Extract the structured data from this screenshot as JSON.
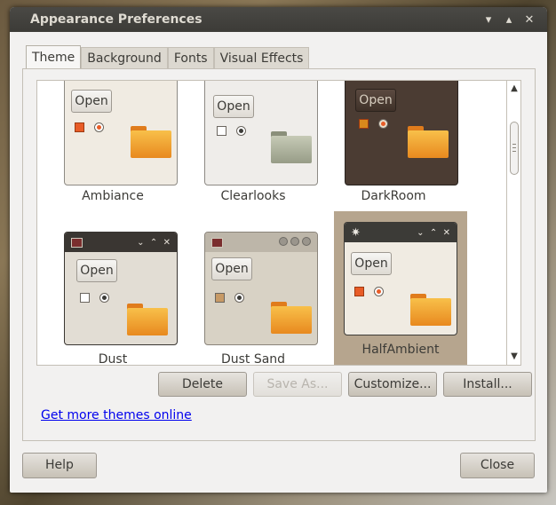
{
  "window": {
    "title": "Appearance Preferences"
  },
  "titlebar_controls": [
    "▾",
    "▴",
    "✕"
  ],
  "tabs": [
    {
      "label": "Theme",
      "active": true
    },
    {
      "label": "Background",
      "active": false
    },
    {
      "label": "Fonts",
      "active": false
    },
    {
      "label": "Visual Effects",
      "active": false
    }
  ],
  "themes": [
    {
      "name": "Ambiance",
      "open_label": "Open"
    },
    {
      "name": "Clearlooks",
      "open_label": "Open"
    },
    {
      "name": "DarkRoom",
      "open_label": "Open"
    },
    {
      "name": "Dust",
      "open_label": "Open"
    },
    {
      "name": "Dust Sand",
      "open_label": "Open"
    },
    {
      "name": "HalfAmbient",
      "open_label": "Open",
      "selected": true
    }
  ],
  "buttons": {
    "delete": "Delete",
    "save_as": "Save As...",
    "customize": "Customize...",
    "install": "Install...",
    "help": "Help",
    "close": "Close"
  },
  "link": "Get more themes online",
  "colors": {
    "accent": "#e85c27",
    "selection": "#b6a58e",
    "titlebar": "#3c3b37"
  }
}
